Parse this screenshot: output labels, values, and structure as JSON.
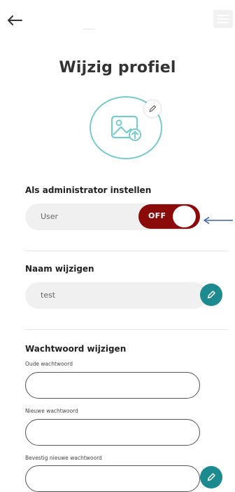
{
  "header": {
    "back_icon": "arrow-left-icon",
    "menu_icon": "hamburger-menu-icon"
  },
  "page_title": "Wijzig profiel",
  "avatar": {
    "icon": "image-upload-icon",
    "edit_icon": "pencil-icon",
    "border_color": "#79cacb"
  },
  "admin": {
    "title": "Als administrator instellen",
    "role_label": "User",
    "toggle_label": "OFF",
    "toggle_on": false,
    "toggle_color": "#8b0a0a",
    "annotation_arrow_color": "#3d62a8"
  },
  "name": {
    "title": "Naam wijzigen",
    "value": "test",
    "edit_icon": "pencil-icon",
    "button_color": "#1c8a8e"
  },
  "password": {
    "title": "Wachtwoord wijzigen",
    "old_label": "Oude wachtwoord",
    "new_label": "Nieuwe wachtwoord",
    "confirm_label": "Bevestig nieuwe wachtwoord",
    "old_value": "",
    "new_value": "",
    "confirm_value": "",
    "save_icon": "pencil-icon"
  }
}
